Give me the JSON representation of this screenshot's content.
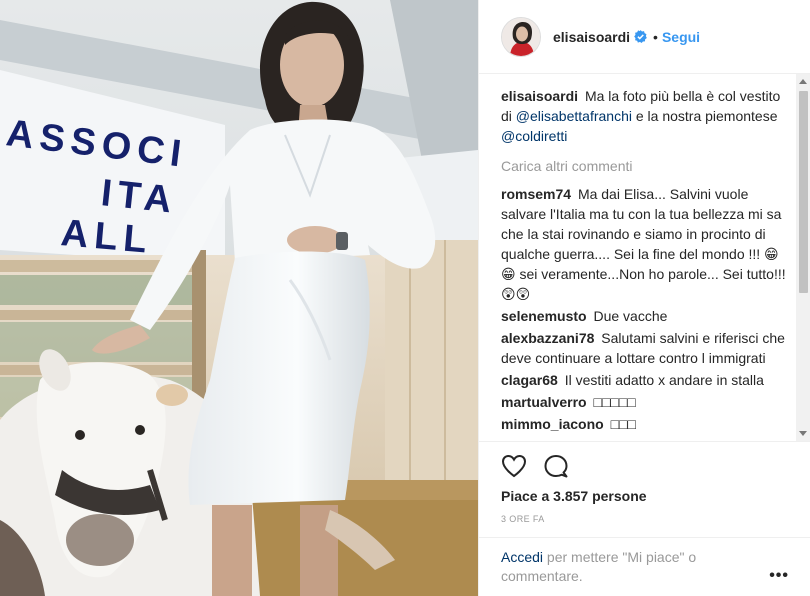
{
  "header": {
    "username": "elisaisoardi",
    "separator": "•",
    "follow_label": "Segui"
  },
  "photo": {
    "banner_lines": [
      "ASSOCI",
      "ITA",
      "ALL"
    ],
    "banner_color": "#15216b"
  },
  "caption": {
    "username": "elisaisoardi",
    "text_1": "Ma la foto più bella è col vestito di",
    "mention_1": "@elisabettafranchi",
    "text_2": "e la nostra piemontese",
    "mention_2": "@coldiretti"
  },
  "load_more_label": "Carica altri commenti",
  "comments": [
    {
      "username": "romsem74",
      "text": "Ma dai Elisa... Salvini vuole salvare l'Italia ma tu con la tua bellezza mi sa che la stai rovinando e siamo in procinto di qualche guerra.... Sei la fine del mondo !!! 😁😁 sei veramente...Non ho parole... Sei tutto!!! 😲😲"
    },
    {
      "username": "selenemusto",
      "text": "Due vacche"
    },
    {
      "username": "alexbazzani78",
      "text": "Salutami salvini e riferisci che deve continuare a lottare contro l immigrati"
    },
    {
      "username": "clagar68",
      "text": "Il vestiti adatto x andare in stalla"
    },
    {
      "username": "martualverro",
      "text": "□□□□□"
    },
    {
      "username": "mimmo_iacono",
      "text": "□□□"
    }
  ],
  "actions": {
    "like_icon": "heart-outline-icon",
    "comment_icon": "comment-bubble-icon",
    "likes_text": "Piace a 3.857 persone",
    "time_text": "3 ORE FA"
  },
  "add_comment": {
    "login_label": "Accedi",
    "prompt": "per mettere \"Mi piace\" o commentare.",
    "more_label": "•••"
  },
  "colors": {
    "link_blue": "#3897f0",
    "mention_blue": "#003569",
    "muted_gray": "#999999",
    "text_dark": "#262626"
  }
}
